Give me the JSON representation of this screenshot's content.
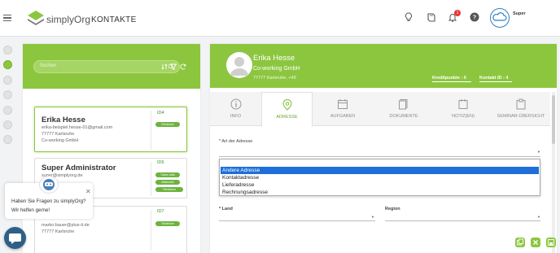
{
  "brand": "simplyOrg",
  "page_title": "KONTAKTE",
  "notification_count": "1",
  "user_name": "Super",
  "search": {
    "placeholder": "Suchen"
  },
  "contacts": [
    {
      "name": "Erika Hesse",
      "email": "erika-beispiel.hesse-01@gmail.com",
      "city": "77777 Karlsruhe",
      "company": "Co-working GmbH",
      "id": "ID4",
      "tags": [
        "Teilnehmer"
      ]
    },
    {
      "name": "Super Administrator",
      "email": "super@simplyorg.de",
      "id": "ID5",
      "tags": [
        "Trainer aktiv",
        "Mitarbeiter",
        "Teilnehmer"
      ]
    },
    {
      "name": "",
      "email": "marko.bauer@plus-it.de",
      "city": "77777 Karlsruhe",
      "id": "ID7",
      "tags": [
        "Teilnehmer"
      ]
    }
  ],
  "detail": {
    "name": "Erika Hesse",
    "company": "Co-working GmbH",
    "address": "77777 Karlsruhe, +49",
    "credit_points": "Kreditpunkte : 0",
    "contact_id": "Kontakt ID : 4"
  },
  "tabs": [
    {
      "label": "INFO",
      "icon": "info-icon"
    },
    {
      "label": "ADRESSE",
      "icon": "map-pin-icon",
      "active": true
    },
    {
      "label": "AUFGABEN",
      "icon": "calendar-icon"
    },
    {
      "label": "DOKUMENTE",
      "icon": "documents-icon"
    },
    {
      "label": "NOTIZ(EN)",
      "icon": "notes-icon"
    },
    {
      "label": "SEMINAR-ÜBERSICHT",
      "icon": "clipboard-icon"
    }
  ],
  "address_form": {
    "type_label": "* Art der Adresse",
    "type_options": [
      "Andere Adresse",
      "Kontaktadresse",
      "Lieferadresse",
      "Rechnungsadresse"
    ],
    "type_selected": "Andere Adresse",
    "country_label": "* Land",
    "region_label": "Region"
  },
  "chat": {
    "message": "Haben Sie Fragen zu simplyOrg? Wir helfen gerne!"
  },
  "colors": {
    "accent": "#8cc63f",
    "selection": "#1e6fd9",
    "badge": "#ee3333"
  }
}
